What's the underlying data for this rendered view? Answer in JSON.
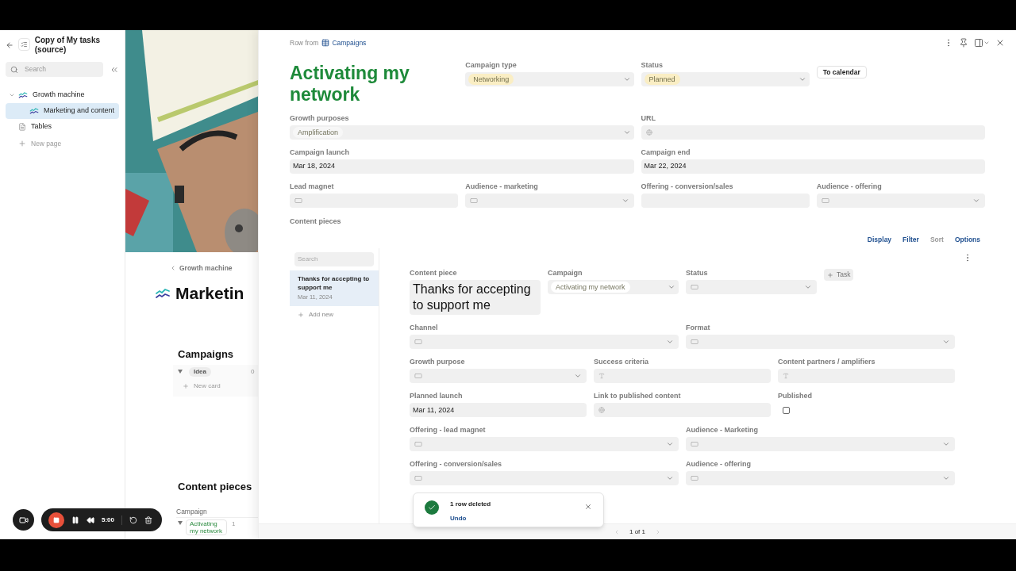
{
  "sidebar": {
    "title": "Copy of My tasks (source)",
    "search": {
      "placeholder": "Search"
    },
    "items": [
      {
        "label": "Growth machine",
        "expanded": true,
        "selected": false,
        "children": [
          {
            "label": "Marketing and content",
            "selected": true
          }
        ]
      },
      {
        "label": "Tables",
        "selected": false
      }
    ],
    "new_page": "New page"
  },
  "page": {
    "breadcrumb": "Growth machine",
    "title": "Marketin",
    "campaigns": {
      "heading": "Campaigns",
      "group": "Idea",
      "count": "0",
      "new_card": "New card"
    },
    "content_pieces": {
      "heading": "Content pieces",
      "column": "Campaign",
      "group": "Activating my network",
      "count": "1"
    }
  },
  "recorder": {
    "time": "5:00"
  },
  "record": {
    "row_from": "Row from",
    "source": "Campaigns",
    "title": "Activating my network",
    "header_fields": [
      {
        "label": "Campaign type",
        "kind": "select",
        "tag": {
          "text": "Networking",
          "color": "#faeec4"
        }
      },
      {
        "label": "Status",
        "kind": "select",
        "tag": {
          "text": "Planned",
          "color": "#faeec4"
        }
      }
    ],
    "action": "To calendar",
    "rows": [
      [
        {
          "label": "Growth purposes",
          "kind": "select",
          "tag": {
            "text": "Amplification",
            "color": "#f7f7f7"
          }
        },
        {
          "label": "URL",
          "kind": "url"
        }
      ],
      [
        {
          "label": "Campaign launch",
          "kind": "date",
          "value": "Mar 18, 2024"
        },
        {
          "label": "Campaign end",
          "kind": "date",
          "value": "Mar 22, 2024"
        }
      ],
      [
        {
          "label": "Lead magnet",
          "kind": "reference"
        },
        {
          "label": "Audience - marketing",
          "kind": "relation"
        },
        {
          "label": "Offering - conversion/sales",
          "kind": "empty"
        },
        {
          "label": "Audience - offering",
          "kind": "relation"
        }
      ]
    ],
    "section": "Content pieces",
    "toolbar": [
      {
        "label": "Display",
        "disabled": false
      },
      {
        "label": "Filter",
        "disabled": false
      },
      {
        "label": "Sort",
        "disabled": true
      },
      {
        "label": "Options",
        "disabled": false
      }
    ],
    "list": {
      "search": {
        "placeholder": "Search"
      },
      "items": [
        {
          "title": "Thanks for accepting to support me",
          "date": "Mar 11, 2024",
          "selected": true
        }
      ],
      "add_new": "Add new"
    },
    "detail": {
      "title_label": "Content piece",
      "title": "Thanks for accepting to support me",
      "header_fields": [
        {
          "label": "Campaign",
          "kind": "select",
          "tag": {
            "text": "Activating my network",
            "color": "#ffffff"
          }
        },
        {
          "label": "Status",
          "kind": "relation"
        }
      ],
      "action": "Task",
      "rows": [
        [
          {
            "label": "Channel",
            "kind": "relation"
          },
          {
            "label": "Format",
            "kind": "relation"
          }
        ],
        [
          {
            "label": "Growth purpose",
            "kind": "relation"
          },
          {
            "label": "Success criteria",
            "kind": "text"
          },
          {
            "label": "Content partners / amplifiers",
            "kind": "text"
          }
        ],
        [
          {
            "label": "Planned launch",
            "kind": "date",
            "value": "Mar 11, 2024"
          },
          {
            "label": "Link to published content",
            "kind": "url"
          },
          {
            "label": "Published",
            "kind": "checkbox",
            "checked": false
          }
        ],
        [
          {
            "label": "Offering - lead magnet",
            "kind": "relation"
          },
          {
            "label": "Audience - Marketing",
            "kind": "relation"
          }
        ],
        [
          {
            "label": "Offering - conversion/sales",
            "kind": "relation"
          },
          {
            "label": "Audience - offering",
            "kind": "relation"
          }
        ]
      ]
    },
    "pagination": "1 of 1"
  },
  "toast": {
    "message": "1 row deleted",
    "action": "Undo"
  }
}
